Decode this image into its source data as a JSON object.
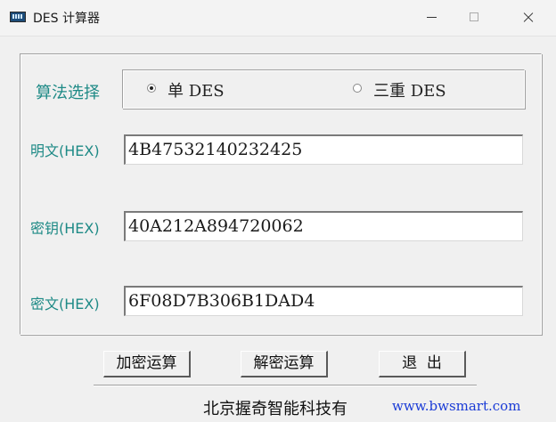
{
  "window": {
    "title": "DES 计算器"
  },
  "algorithm": {
    "label": "算法选择",
    "options": [
      {
        "label": "单 DES",
        "selected": true
      },
      {
        "label": "三重 DES",
        "selected": false
      }
    ]
  },
  "fields": {
    "plaintext": {
      "label": "明文(HEX)",
      "value": "4B47532140232425"
    },
    "key": {
      "label": "密钥(HEX)",
      "value": "40A212A894720062"
    },
    "ciphertext": {
      "label": "密文(HEX)",
      "value": "6F08D7B306B1DAD4"
    }
  },
  "buttons": {
    "encrypt": "加密运算",
    "decrypt": "解密运算",
    "exit": "退  出"
  },
  "footer": {
    "company": "北京握奇智能科技有",
    "url": "www.bwsmart.com"
  },
  "colors": {
    "label_teal": "#1e8a86",
    "link_blue": "#1a3bd6"
  }
}
